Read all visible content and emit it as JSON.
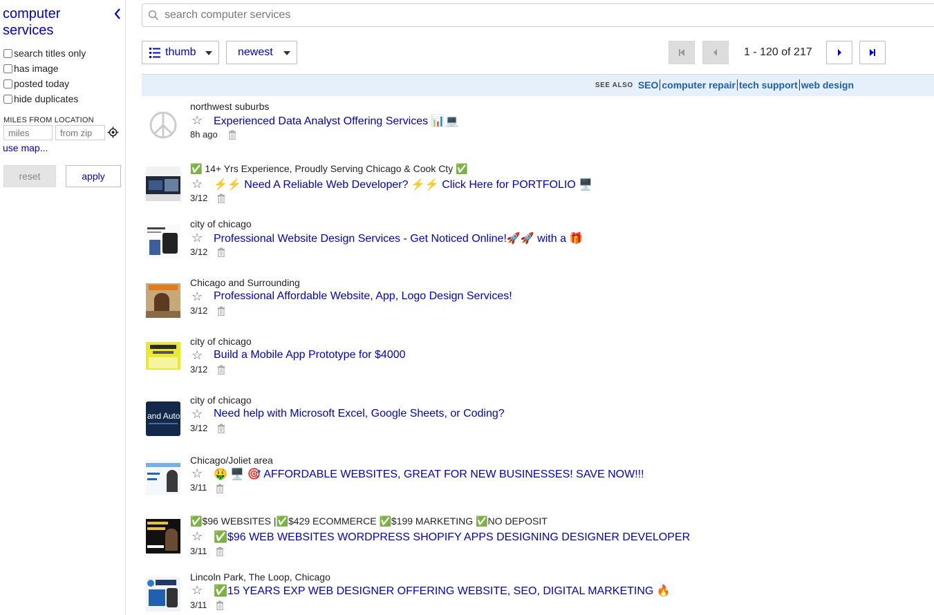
{
  "sidebar": {
    "title": "computer services",
    "filters": [
      "search titles only",
      "has image",
      "posted today",
      "hide duplicates"
    ],
    "miles_label": "MILES FROM LOCATION",
    "miles_placeholder": "miles",
    "zip_placeholder": "from zip",
    "use_map": "use map...",
    "reset": "reset",
    "apply": "apply"
  },
  "search": {
    "placeholder": "search computer services"
  },
  "toolbar": {
    "view_mode": "thumb",
    "sort": "newest",
    "range": "1 - 120 of 217"
  },
  "see_also": {
    "label": "SEE ALSO",
    "links": [
      "SEO",
      "computer repair",
      "tech support",
      "web design"
    ]
  },
  "icons": {
    "search": "search-icon",
    "collapse": "chevron-left-icon",
    "locate": "crosshair-icon",
    "list": "list-icon",
    "star": "star-icon",
    "trash": "trash-icon"
  },
  "colors": {
    "link": "#0000cc",
    "see_also_bg": "#e6f0fa",
    "check_green": "#22a93b"
  },
  "listings": [
    {
      "location": "northwest suburbs",
      "title": "Experienced Data Analyst Offering Services 📊💻",
      "date": "8h ago"
    },
    {
      "location": "✅ 14+ Yrs Experience, Proudly Serving Chicago & Cook Cty ✅",
      "title": "⚡⚡ Need A Reliable Web Developer? ⚡⚡ Click Here for PORTFOLIO 🖥️",
      "date": "3/12"
    },
    {
      "location": "city of chicago",
      "title": "Professional Website Design Services - Get Noticed Online!🚀🚀 with a 🎁",
      "date": "3/12"
    },
    {
      "location": "Chicago and Surrounding",
      "title": "Professional Affordable Website, App, Logo Design Services!",
      "date": "3/12"
    },
    {
      "location": "city of chicago",
      "title": "Build a Mobile App Prototype for $4000",
      "date": "3/12"
    },
    {
      "location": "city of chicago",
      "title": "Need help with Microsoft Excel, Google Sheets, or Coding?",
      "date": "3/12"
    },
    {
      "location": "Chicago/Joliet area",
      "title": "🤑 🖥️ 🎯 AFFORDABLE WEBSITES, GREAT FOR NEW BUSINESSES! SAVE NOW!!!",
      "date": "3/11"
    },
    {
      "location": "✅$96 WEBSITES |✅$429 ECOMMERCE ✅$199 MARKETING ✅NO DEPOSIT",
      "title": "✅$96 WEB WEBSITES WORDPRESS SHOPIFY APPS DESIGNING DESIGNER DEVELOPER",
      "date": "3/11"
    },
    {
      "location": "Lincoln Park, The Loop, Chicago",
      "title": "✅15 YEARS EXP WEB DESIGNER OFFERING WEBSITE, SEO, DIGITAL MARKETING 🔥",
      "date": "3/11"
    }
  ]
}
